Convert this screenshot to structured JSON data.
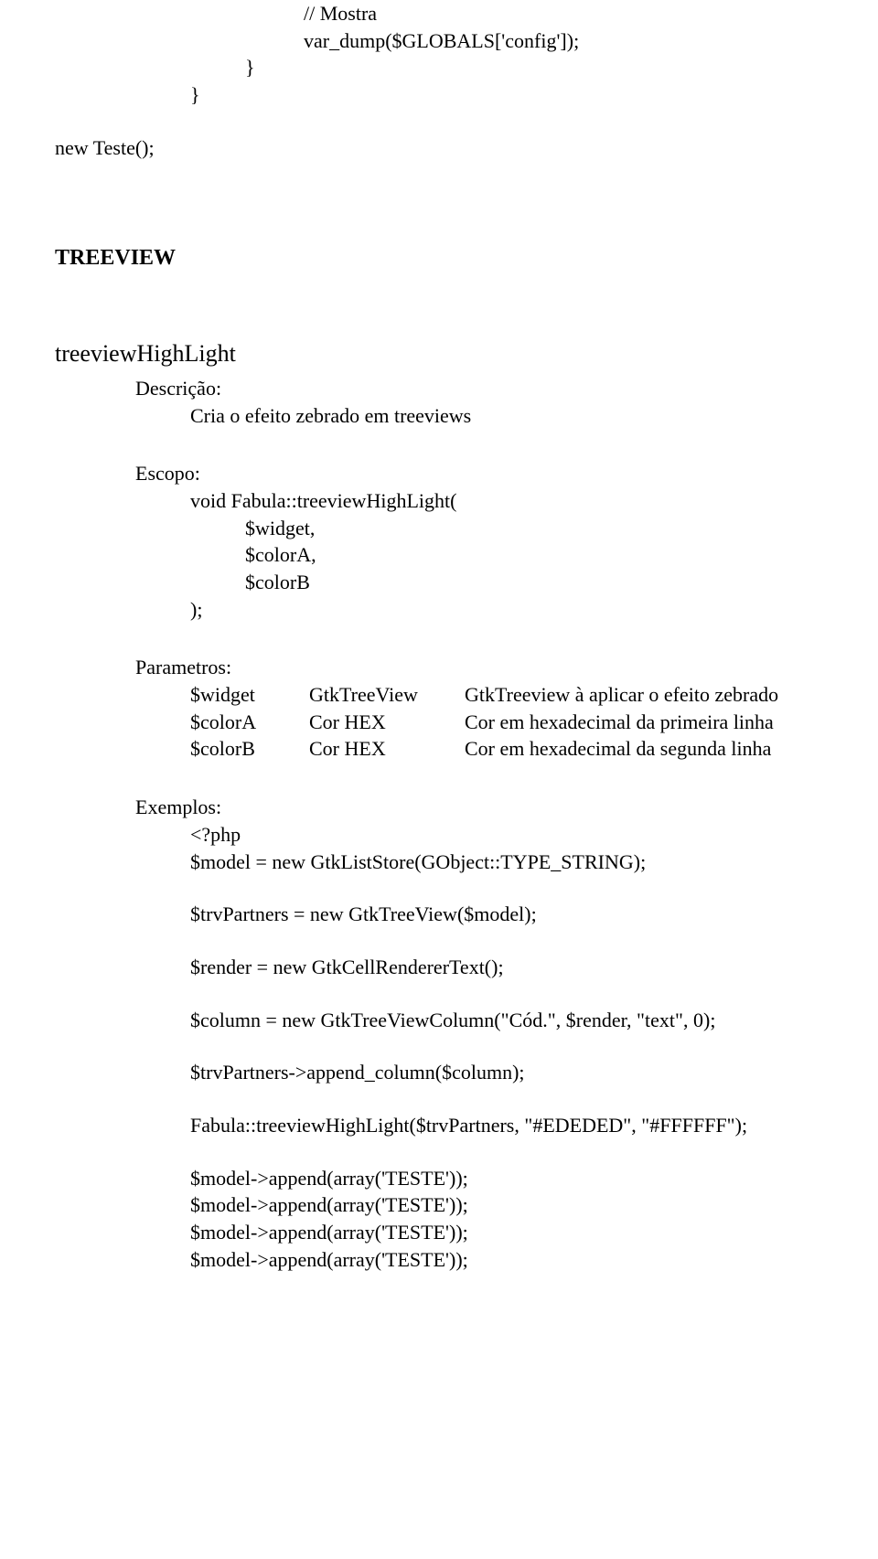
{
  "topcode": {
    "l1": "// Mostra",
    "l2": "var_dump($GLOBALS['config']);",
    "l3": "}",
    "l4": "}",
    "l5": "new Teste();"
  },
  "section": "TREEVIEW",
  "func": {
    "name": "treeviewHighLight",
    "desc_label": "Descrição:",
    "desc_text": "Cria o efeito zebrado em treeviews",
    "esc_label": "Escopo:",
    "esc_l1": "void Fabula::treeviewHighLight(",
    "esc_l2": "$widget,",
    "esc_l3": "$colorA,",
    "esc_l4": "$colorB",
    "esc_l5": ");",
    "par_label": "Parametros:",
    "params": [
      {
        "name": "$widget",
        "type": "GtkTreeView",
        "desc": "GtkTreeview à aplicar o efeito zebrado"
      },
      {
        "name": "$colorA",
        "type": "Cor HEX",
        "desc": "Cor em hexadecimal da primeira linha"
      },
      {
        "name": "$colorB",
        "type": "Cor HEX",
        "desc": "Cor em hexadecimal da segunda linha"
      }
    ],
    "ex_label": "Exemplos:",
    "ex": {
      "l1": "<?php",
      "l2": "$model = new GtkListStore(GObject::TYPE_STRING);",
      "l3": "$trvPartners = new GtkTreeView($model);",
      "l4": "$render = new GtkCellRendererText();",
      "l5": "$column = new GtkTreeViewColumn(\"Cód.\", $render, \"text\", 0);",
      "l6": "$trvPartners->append_column($column);",
      "l7": "Fabula::treeviewHighLight($trvPartners, \"#EDEDED\", \"#FFFFFF\");",
      "l8": "$model->append(array('TESTE'));",
      "l9": "$model->append(array('TESTE'));",
      "l10": "$model->append(array('TESTE'));",
      "l11": "$model->append(array('TESTE'));"
    }
  }
}
